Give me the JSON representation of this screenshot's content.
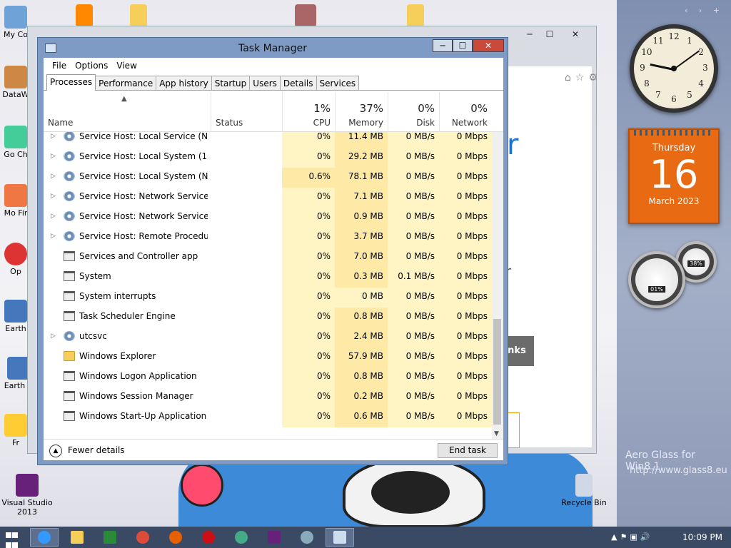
{
  "desktop": {
    "icons": [
      {
        "label": "My Co"
      },
      {
        "label": "DataW"
      },
      {
        "label": "Go Ch"
      },
      {
        "label": "Mo Fir"
      },
      {
        "label": "Op"
      },
      {
        "label": "Earth"
      },
      {
        "label": "Earth B"
      },
      {
        "label": "Fr"
      },
      {
        "label": "Visual Studio 2013"
      },
      {
        "label": "Recycle Bin"
      }
    ],
    "aero_line1": "Aero Glass for Win8.1",
    "aero_line2": "http://www.glass8.eu"
  },
  "gadgets": {
    "clock_numbers": [
      "12",
      "1",
      "2",
      "3",
      "4",
      "5",
      "6",
      "7",
      "8",
      "9",
      "10",
      "11"
    ],
    "calendar": {
      "weekday": "Thursday",
      "day": "16",
      "month_year": "March 2023"
    },
    "gauge_cpu": "01%",
    "gauge_mem": "38%"
  },
  "background_window": {
    "text_r": "r",
    "text_r2": "r",
    "text_nks": "nks"
  },
  "task_manager": {
    "title": "Task Manager",
    "controls": {
      "minimize": "─",
      "maximize": "☐",
      "close": "✕"
    },
    "menu": [
      "File",
      "Options",
      "View"
    ],
    "tabs": [
      "Processes",
      "Performance",
      "App history",
      "Startup",
      "Users",
      "Details",
      "Services"
    ],
    "active_tab": "Processes",
    "columns": {
      "name": "Name",
      "status": "Status",
      "cpu": {
        "pct": "1%",
        "label": "CPU"
      },
      "memory": {
        "pct": "37%",
        "label": "Memory"
      },
      "disk": {
        "pct": "0%",
        "label": "Disk"
      },
      "network": {
        "pct": "0%",
        "label": "Network"
      }
    },
    "rows": [
      {
        "expand": true,
        "icon": "gear",
        "name": "Service Host: Local Service (No ...",
        "cpu": "0%",
        "mem": "11.4 MB",
        "disk": "0 MB/s",
        "net": "0 Mbps"
      },
      {
        "expand": true,
        "icon": "gear",
        "name": "Service Host: Local System (17)",
        "cpu": "0%",
        "mem": "29.2 MB",
        "disk": "0 MB/s",
        "net": "0 Mbps"
      },
      {
        "expand": true,
        "icon": "gear",
        "name": "Service Host: Local System (Net...",
        "cpu": "0.6%",
        "mem": "78.1 MB",
        "disk": "0 MB/s",
        "net": "0 Mbps"
      },
      {
        "expand": true,
        "icon": "gear",
        "name": "Service Host: Network Service (5)",
        "cpu": "0%",
        "mem": "7.1 MB",
        "disk": "0 MB/s",
        "net": "0 Mbps"
      },
      {
        "expand": true,
        "icon": "gear",
        "name": "Service Host: Network Service (...",
        "cpu": "0%",
        "mem": "0.9 MB",
        "disk": "0 MB/s",
        "net": "0 Mbps"
      },
      {
        "expand": true,
        "icon": "gear",
        "name": "Service Host: Remote Procedure...",
        "cpu": "0%",
        "mem": "3.7 MB",
        "disk": "0 MB/s",
        "net": "0 Mbps"
      },
      {
        "expand": false,
        "icon": "app",
        "name": "Services and Controller app",
        "cpu": "0%",
        "mem": "7.0 MB",
        "disk": "0 MB/s",
        "net": "0 Mbps"
      },
      {
        "expand": false,
        "icon": "app",
        "name": "System",
        "cpu": "0%",
        "mem": "0.3 MB",
        "disk": "0.1 MB/s",
        "net": "0 Mbps"
      },
      {
        "expand": false,
        "icon": "app",
        "name": "System interrupts",
        "cpu": "0%",
        "mem": "0 MB",
        "disk": "0 MB/s",
        "net": "0 Mbps"
      },
      {
        "expand": false,
        "icon": "app",
        "name": "Task Scheduler Engine",
        "cpu": "0%",
        "mem": "0.8 MB",
        "disk": "0 MB/s",
        "net": "0 Mbps"
      },
      {
        "expand": true,
        "icon": "gear",
        "name": "utcsvc",
        "cpu": "0%",
        "mem": "2.4 MB",
        "disk": "0 MB/s",
        "net": "0 Mbps"
      },
      {
        "expand": false,
        "icon": "folder",
        "name": "Windows Explorer",
        "cpu": "0%",
        "mem": "57.9 MB",
        "disk": "0 MB/s",
        "net": "0 Mbps"
      },
      {
        "expand": false,
        "icon": "app",
        "name": "Windows Logon Application",
        "cpu": "0%",
        "mem": "0.8 MB",
        "disk": "0 MB/s",
        "net": "0 Mbps"
      },
      {
        "expand": false,
        "icon": "app",
        "name": "Windows Session Manager",
        "cpu": "0%",
        "mem": "0.2 MB",
        "disk": "0 MB/s",
        "net": "0 Mbps"
      },
      {
        "expand": false,
        "icon": "app",
        "name": "Windows Start-Up Application",
        "cpu": "0%",
        "mem": "0.6 MB",
        "disk": "0 MB/s",
        "net": "0 Mbps"
      }
    ],
    "fewer_details": "Fewer details",
    "end_task": "End task"
  },
  "taskbar": {
    "time": "10:09 PM",
    "apps": [
      "internet-explorer",
      "file-explorer",
      "store",
      "chrome",
      "firefox",
      "opera",
      "chrome-alt",
      "visual-studio",
      "network",
      "task-manager"
    ]
  }
}
